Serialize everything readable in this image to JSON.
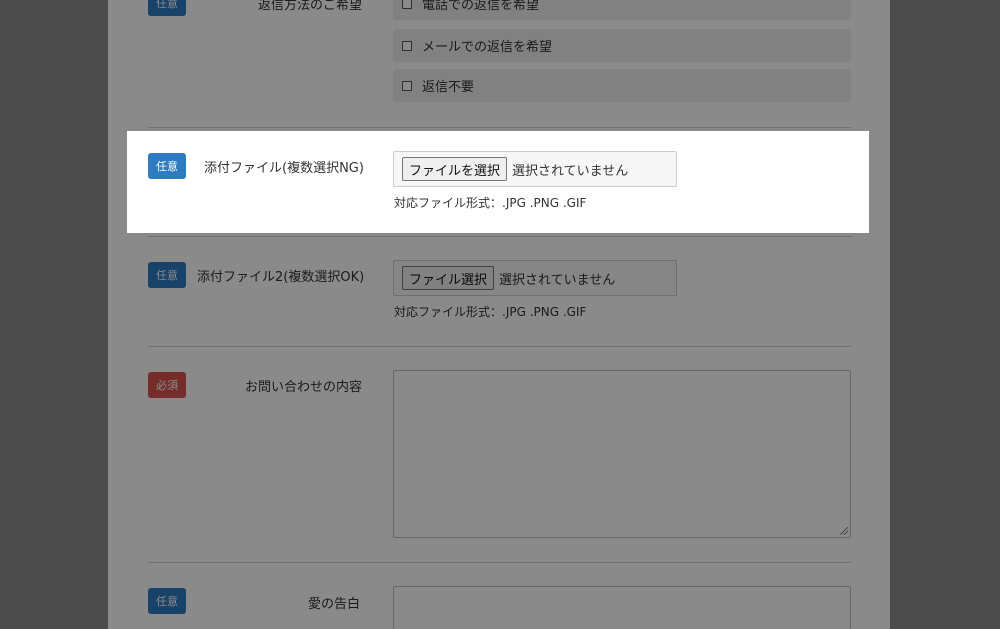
{
  "badges": {
    "optional": "任意",
    "required": "必須"
  },
  "reply_method": {
    "label": "返信方法のご希望",
    "options": [
      "電話での返信を希望",
      "メールでの返信を希望",
      "返信不要"
    ]
  },
  "attachment1": {
    "label": "添付ファイル(複数選択NG)",
    "button": "ファイルを選択",
    "status": "選択されていません",
    "hint": "対応ファイル形式：.JPG .PNG .GIF"
  },
  "attachment2": {
    "label": "添付ファイル2(複数選択OK)",
    "button": "ファイル選択",
    "status": "選択されていません",
    "hint": "対応ファイル形式：.JPG .PNG .GIF"
  },
  "inquiry": {
    "label": "お問い合わせの内容"
  },
  "confession": {
    "label": "愛の告白"
  },
  "colors": {
    "optional_badge": "#2f7bc0",
    "required_badge": "#d9534f",
    "overlay": "rgba(0,0,0,0.46)"
  }
}
